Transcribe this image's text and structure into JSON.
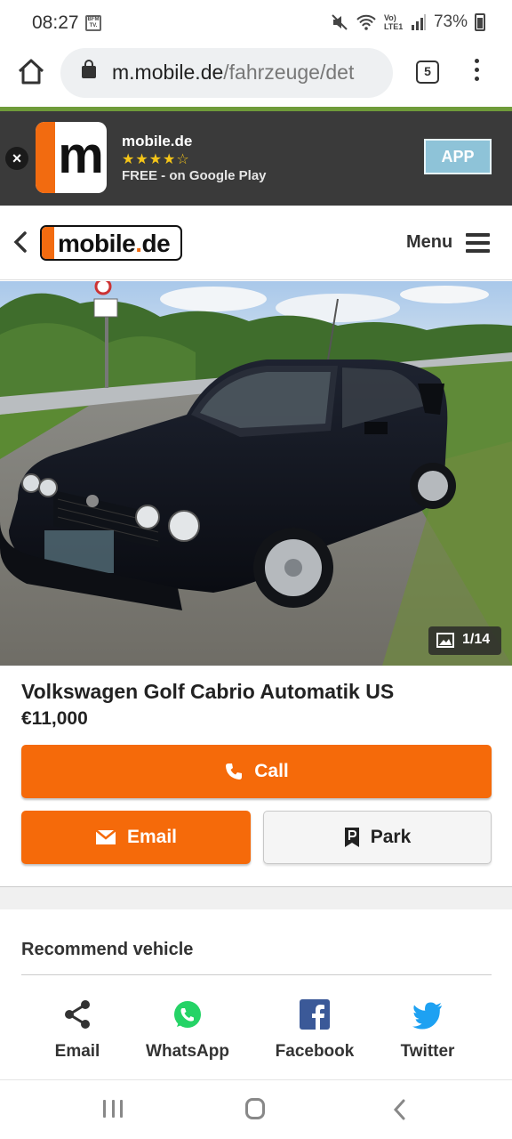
{
  "status_bar": {
    "time": "08:27",
    "notif_label": "BFM TV.",
    "network": "Vo) LTE1",
    "battery": "73%"
  },
  "browser": {
    "url_host": "m.mobile.de",
    "url_path": "/fahrzeuge/det",
    "tab_count": "5"
  },
  "app_banner": {
    "app_name": "mobile.de",
    "rating_stars": "★★★★☆",
    "store_text": "FREE - on Google Play",
    "button_label": "APP",
    "logo_letter": "m"
  },
  "header": {
    "logo_main": "mobile",
    "logo_dot": ".",
    "logo_suffix": "de",
    "menu_label": "Menu"
  },
  "listing": {
    "image_counter": "1/14",
    "title": "Volkswagen Golf Cabrio Automatik US",
    "price": "€11,000",
    "call_label": "Call",
    "email_label": "Email",
    "park_label": "Park"
  },
  "recommend": {
    "title": "Recommend vehicle",
    "items": [
      {
        "label": "Email",
        "icon": "share-icon"
      },
      {
        "label": "WhatsApp",
        "icon": "whatsapp-icon"
      },
      {
        "label": "Facebook",
        "icon": "facebook-icon"
      },
      {
        "label": "Twitter",
        "icon": "twitter-icon"
      }
    ]
  },
  "colors": {
    "accent": "#f56a0a",
    "banner_bg": "#3a3a3a",
    "app_button": "#8ec3d8",
    "whatsapp": "#25d366",
    "facebook": "#3b5998",
    "twitter": "#1da1f2"
  }
}
